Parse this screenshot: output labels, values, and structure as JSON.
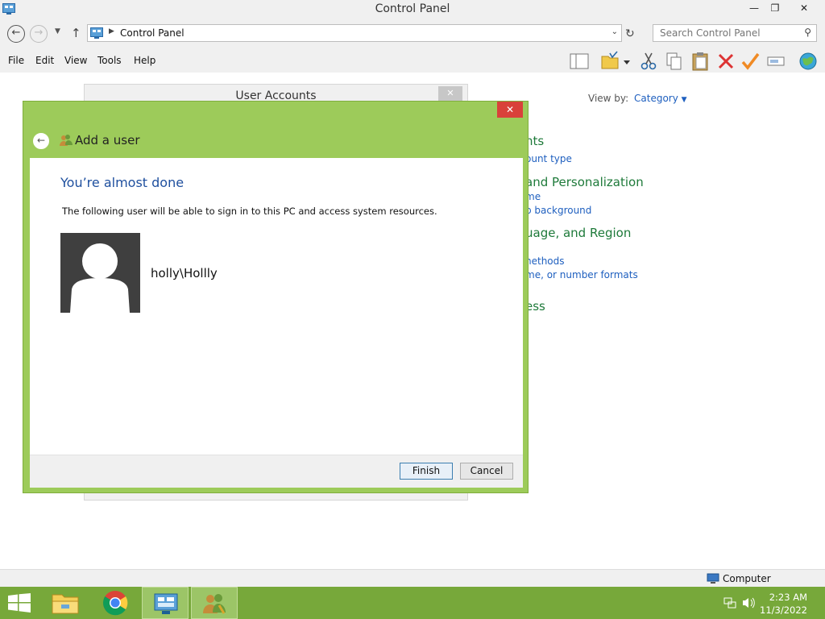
{
  "window": {
    "title": "Control Panel",
    "minimize": "—",
    "maximize": "❐",
    "close": "✕"
  },
  "address": {
    "crumb": "Control Panel",
    "search_placeholder": "Search Control Panel"
  },
  "menu": [
    "File",
    "Edit",
    "View",
    "Tools",
    "Help"
  ],
  "view_by": {
    "label": "View by:",
    "value": "Category"
  },
  "background_panel": [
    "nts",
    "ount type",
    " and Personalization",
    "me",
    "p background",
    "uage, and Region",
    "nethods",
    "me, or number formats",
    "ess"
  ],
  "user_accounts_window": {
    "title": "User Accounts",
    "close": "✕"
  },
  "dialog": {
    "close": "✕",
    "title": "Add a user",
    "heading": "You’re almost done",
    "description": "The following user will be able to sign in to this PC and access system resources.",
    "username": "holly\\Hollly",
    "finish": "Finish",
    "cancel": "Cancel"
  },
  "status": {
    "computer": "Computer"
  },
  "taskbar": {
    "time": "2:23 AM",
    "date": "11/3/2022"
  },
  "colors": {
    "dialog_frame": "#9dcb5a",
    "taskbar": "#77a83a",
    "close_red": "#d9413a",
    "heading_blue": "#1e4f9e",
    "category_green": "#1e7a3a",
    "link_blue": "#1e5fbf"
  }
}
